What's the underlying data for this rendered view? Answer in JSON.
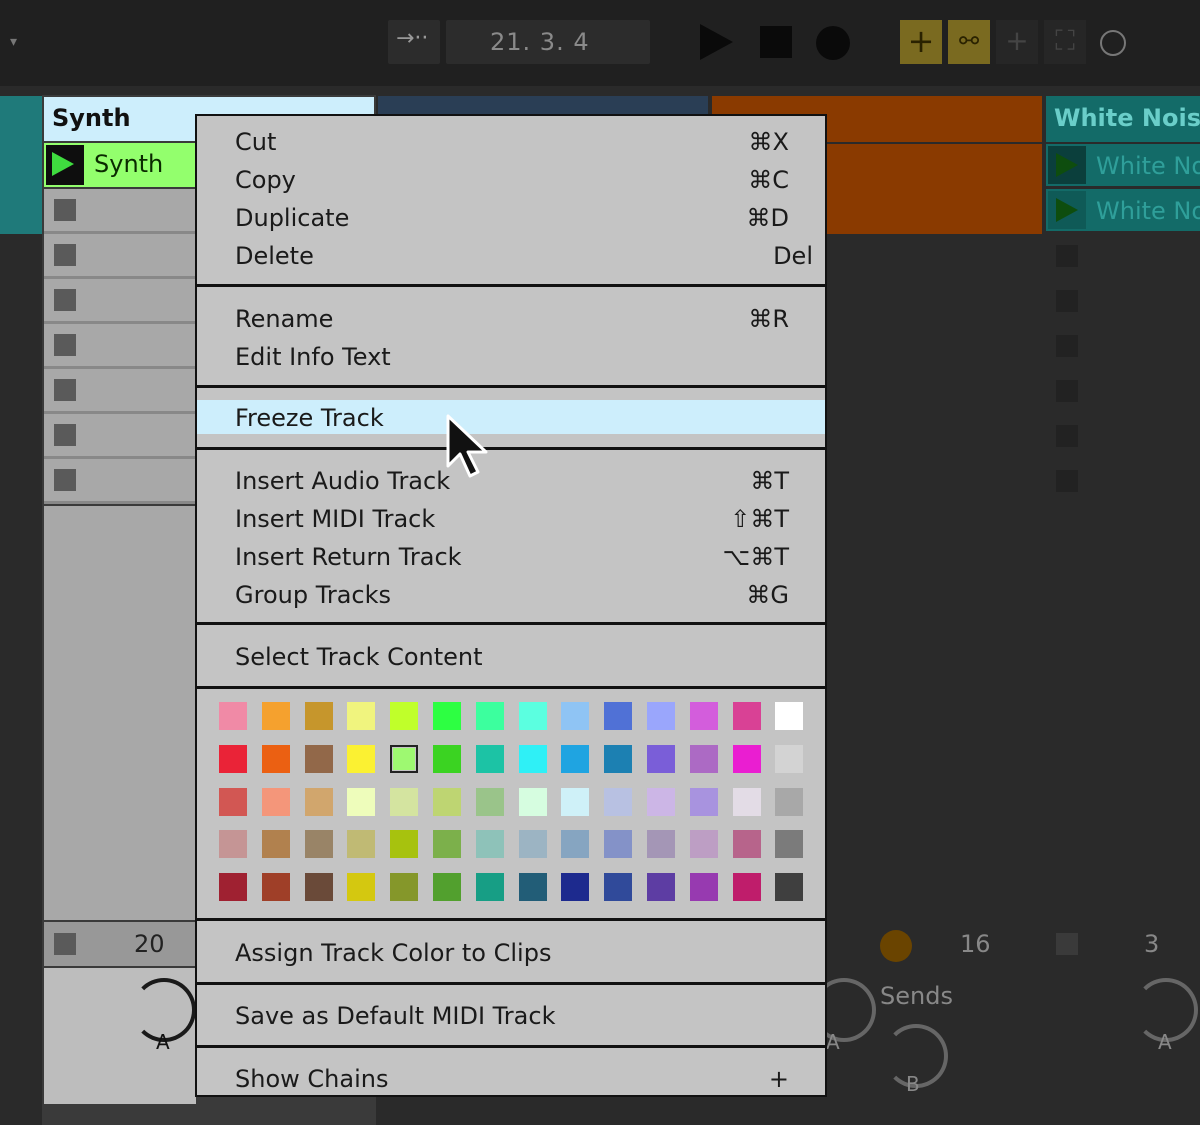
{
  "transport": {
    "position": "21.   3.   4"
  },
  "tracks": {
    "synth": {
      "title": "Synth",
      "clip_name": "Synth",
      "volume_value": "20",
      "send_knob_letter": "A"
    },
    "white_noise": {
      "title": "White Noise",
      "clip_1": "White Noise",
      "clip_2": "White Noise",
      "volume_value": "3",
      "send_knob_letter": "A"
    },
    "orange": {
      "volume_value": "16",
      "sends_label": "Sends",
      "send_a": "A",
      "send_b": "B"
    }
  },
  "context_menu": {
    "groups": [
      [
        {
          "label": "Cut",
          "shortcut": "⌘X"
        },
        {
          "label": "Copy",
          "shortcut": "⌘C"
        },
        {
          "label": "Duplicate",
          "shortcut": "⌘D"
        },
        {
          "label": "Delete",
          "shortcut": "Del"
        }
      ],
      [
        {
          "label": "Rename",
          "shortcut": "⌘R"
        },
        {
          "label": "Edit Info Text",
          "shortcut": ""
        }
      ],
      [
        {
          "label": "Freeze Track",
          "shortcut": "",
          "highlighted": true
        }
      ],
      [
        {
          "label": "Insert Audio Track",
          "shortcut": "⌘T"
        },
        {
          "label": "Insert MIDI Track",
          "shortcut": "⇧⌘T"
        },
        {
          "label": "Insert Return Track",
          "shortcut": "⌥⌘T"
        },
        {
          "label": "Group Tracks",
          "shortcut": "⌘G"
        }
      ],
      [
        {
          "label": "Select Track Content",
          "shortcut": ""
        }
      ],
      [
        {
          "label": "Assign Track Color to Clips",
          "shortcut": ""
        }
      ],
      [
        {
          "label": "Save as Default MIDI Track",
          "shortcut": ""
        }
      ],
      [
        {
          "label": "Show Chains",
          "shortcut": "+"
        }
      ]
    ],
    "color_palette": [
      [
        "#f08aa6",
        "#f5a12e",
        "#c6962c",
        "#f0f47e",
        "#c0ff2a",
        "#2dff42",
        "#3cff9e",
        "#5bffe0",
        "#8fc4f4",
        "#5071d6",
        "#9aa6fc",
        "#d35ddc",
        "#d94195",
        "#ffffff"
      ],
      [
        "#ea2337",
        "#eb6012",
        "#926849",
        "#fbf132",
        "#9ef971",
        "#3bd322",
        "#1cc3a5",
        "#2ff0f6",
        "#1fa4e1",
        "#1c80b2",
        "#7a5ed8",
        "#ac6ac4",
        "#ea1ed1",
        "#d3d3d3"
      ],
      [
        "#d25753",
        "#f4967a",
        "#d1a66d",
        "#eefdbb",
        "#d4e4a0",
        "#bed572",
        "#9ac48a",
        "#d6fde0",
        "#cff1f8",
        "#b8c1e2",
        "#ccb6e6",
        "#a893df",
        "#e3dce6",
        "#a8a8a8"
      ],
      [
        "#c59595",
        "#b1814e",
        "#998467",
        "#c0ba74",
        "#a7c20e",
        "#7cb04b",
        "#8ec2b9",
        "#9cb4c3",
        "#86a5c1",
        "#8492c8",
        "#a496b6",
        "#bd9ec4",
        "#b7648b",
        "#7b7b7b"
      ],
      [
        "#9f2131",
        "#9f3f28",
        "#6a4a39",
        "#d4c810",
        "#85972a",
        "#52a02e",
        "#179e85",
        "#225d77",
        "#1d2a8e",
        "#304a9a",
        "#5d3da3",
        "#973ab0",
        "#bf1d6b",
        "#3f3f3f"
      ]
    ],
    "selected_color": "#9ef971"
  }
}
